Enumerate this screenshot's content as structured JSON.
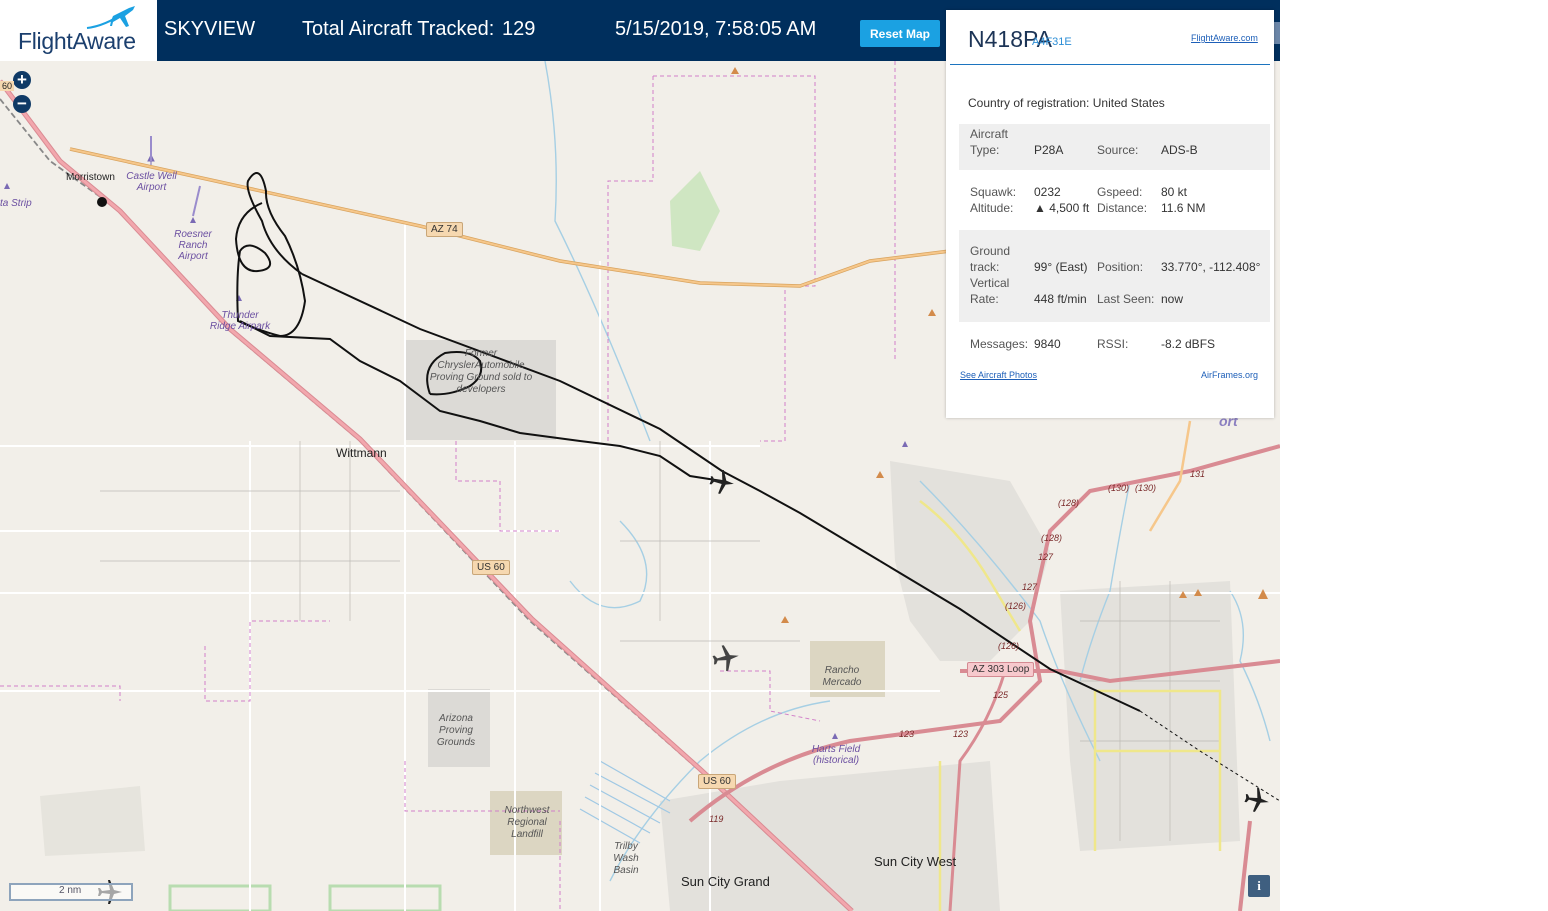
{
  "header": {
    "logo_text": "FlightAware",
    "app_title": "SKYVIEW",
    "total_label": "Total Aircraft Tracked:",
    "total_count": "129",
    "timestamp": "5/15/2019, 7:58:05 AM",
    "reset_label": "Reset Map"
  },
  "map": {
    "zoom_in": "+",
    "zoom_out": "−",
    "scale_label": "2 nm",
    "info_label": "i",
    "places": {
      "morristown": "Morristown",
      "wittmann": "Wittmann",
      "sun_city_grand": "Sun City Grand",
      "sun_city_west": "Sun City West"
    },
    "airports": {
      "strip": "ta Strip",
      "castle_well": "Castle Well Airport",
      "roesner": "Roesner Ranch Airport",
      "thunder_ridge": "Thunder Ridge Airpark",
      "harts_field": "Harts Field (historical)"
    },
    "areas": {
      "chrysler": "Former ChryslerAutomobile Proving Ground sold to developers",
      "arizona_pg": "Arizona Proving Grounds",
      "landfill": "Northwest Regional Landfill",
      "rancho": "Rancho Mercado",
      "trilby": "Trilby Wash Basin"
    },
    "roads": {
      "az74": "AZ 74",
      "us60_a": "US 60",
      "us60_b": "US 60",
      "az303": "AZ 303 Loop",
      "sixty_left": "60",
      "fragment_ort": "ort"
    },
    "road_numbers": [
      "(130)",
      "(130)",
      "131",
      "(128)",
      "(128)",
      "127",
      "127",
      "(126)",
      "(126)",
      "125",
      "123",
      "123",
      "119"
    ]
  },
  "panel": {
    "registration": "N418PA",
    "hex": "A4F31E",
    "fa_link": "FlightAware.com",
    "country_label": "Country of registration:",
    "country_value": "United States",
    "aircraft_type_label": "Aircraft Type:",
    "aircraft_type": "P28A",
    "source_label": "Source:",
    "source": "ADS-B",
    "squawk_label": "Squawk:",
    "squawk": "0232",
    "altitude_label": "Altitude:",
    "altitude": "▲ 4,500 ft",
    "gspeed_label": "Gspeed:",
    "gspeed": "80 kt",
    "distance_label": "Distance:",
    "distance": "11.6 NM",
    "ground_track_label": "Ground track:",
    "ground_track": "99° (East)",
    "position_label": "Position:",
    "position": "33.770°, -112.408°",
    "vertical_rate_label": "Vertical Rate:",
    "vertical_rate": "448 ft/min",
    "last_seen_label": "Last Seen:",
    "last_seen": "now",
    "messages_label": "Messages:",
    "messages": "9840",
    "rssi_label": "RSSI:",
    "rssi": "-8.2 dBFS",
    "photos_link": "See Aircraft Photos",
    "airframes_link": "AirFrames.org"
  },
  "colors": {
    "topbar": "#002f5d",
    "accent": "#1ba1e2",
    "map_bg": "#f2efe9",
    "primary_road": "#e8969e",
    "secondary_road": "#f5c58d",
    "track": "#111111"
  }
}
